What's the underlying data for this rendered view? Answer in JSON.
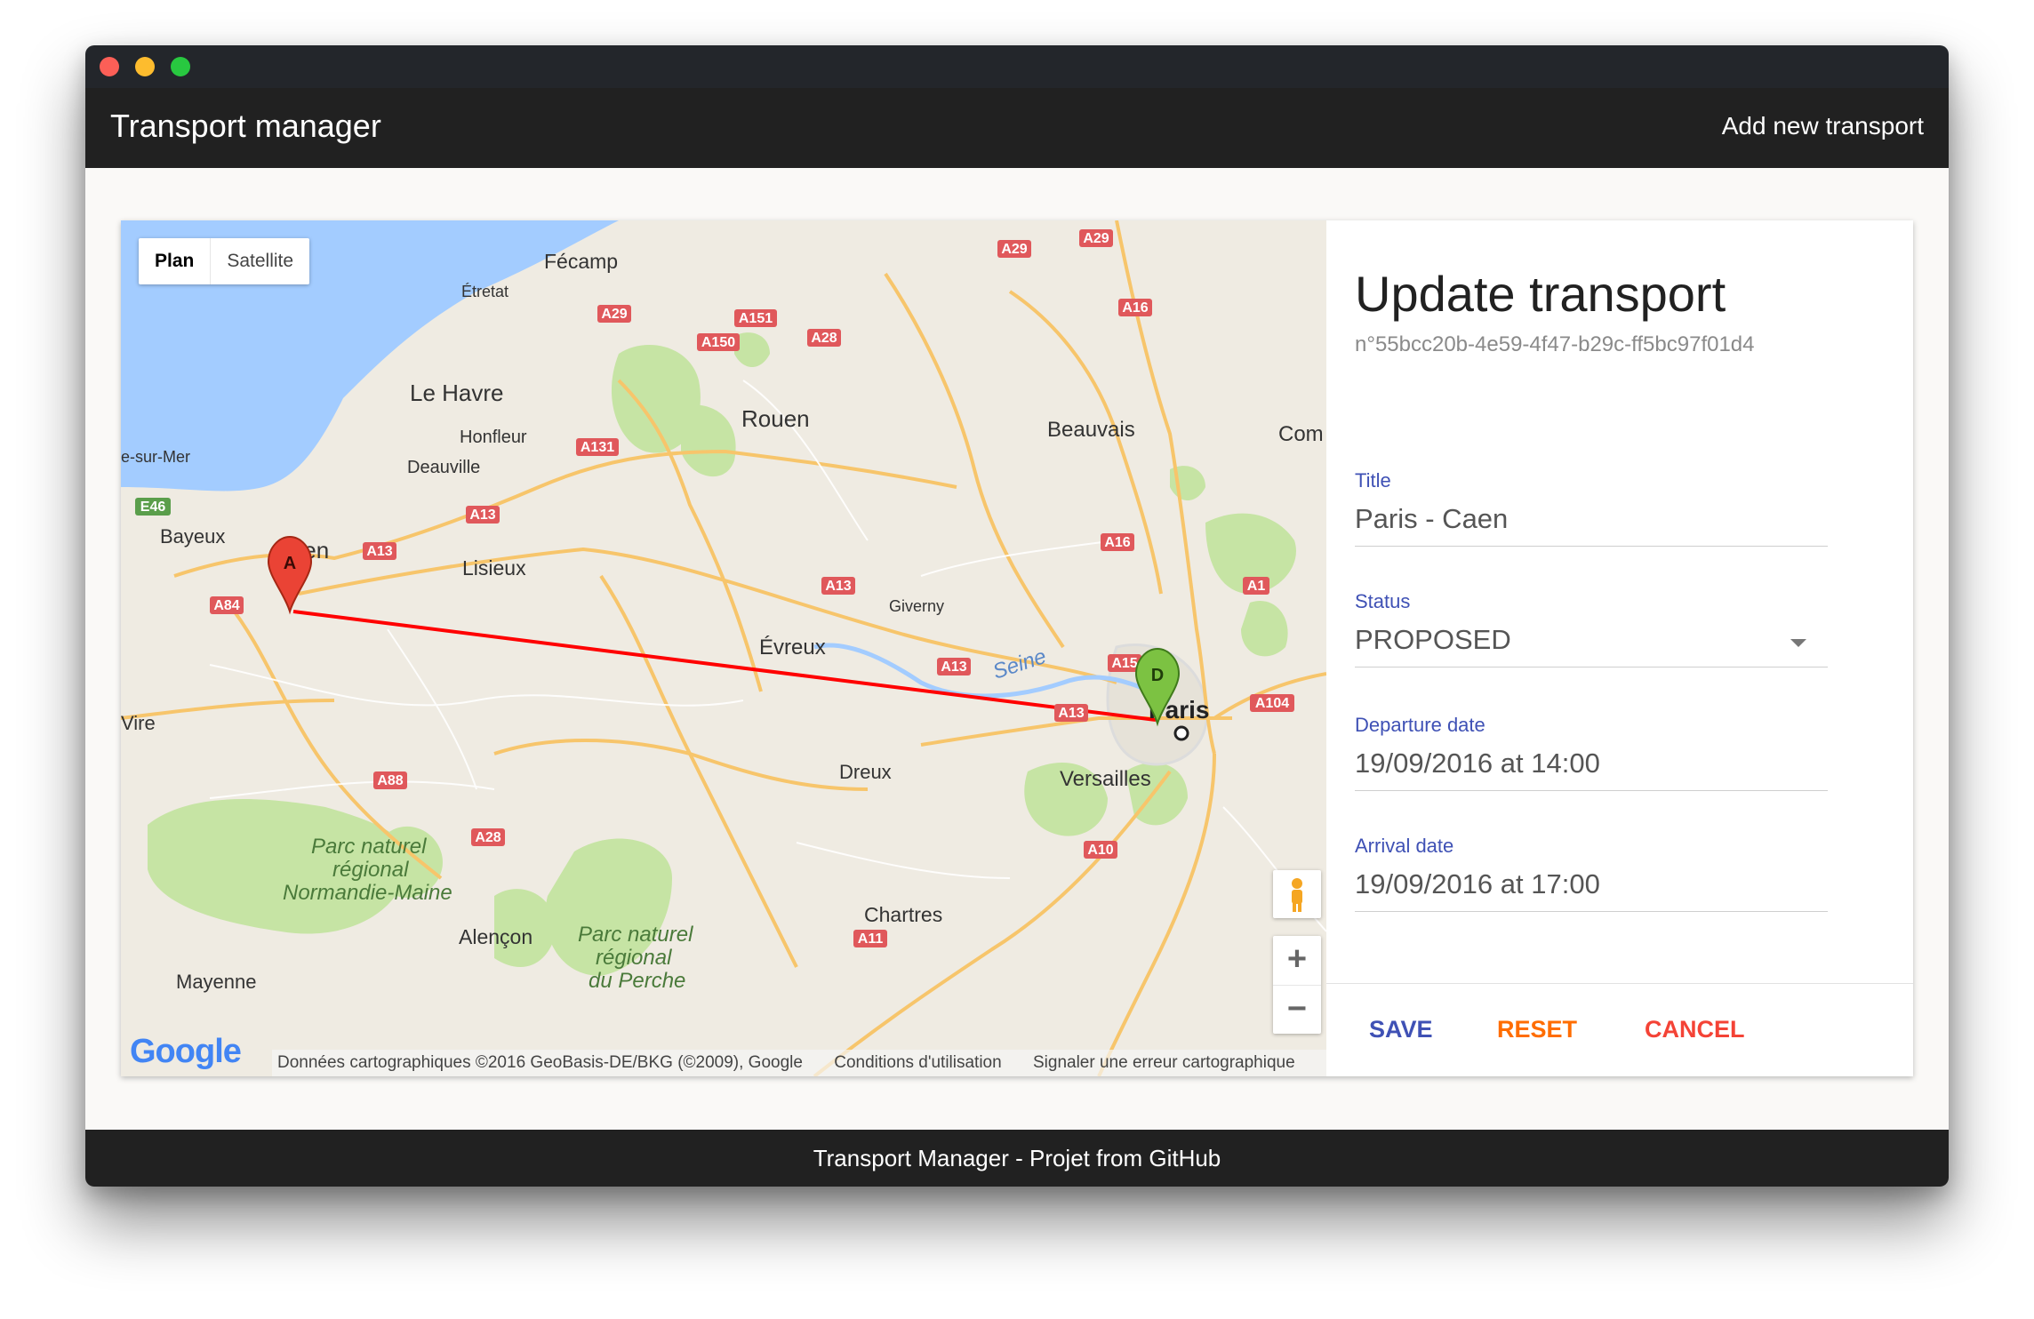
{
  "app": {
    "title": "Transport manager",
    "add_link": "Add new transport"
  },
  "map": {
    "type_plan": "Plan",
    "type_satellite": "Satellite",
    "labels": {
      "fecamp": "Fécamp",
      "etretat": "Étretat",
      "lehavre": "Le Havre",
      "honfleur": "Honfleur",
      "deauville": "Deauville",
      "rouen": "Rouen",
      "beauvais": "Beauvais",
      "surmer": "e-sur-Mer",
      "bayeux": "Bayeux",
      "caen": "Caen",
      "lisieux": "Lisieux",
      "evreux": "Évreux",
      "giverny": "Giverny",
      "seine": "Seine",
      "paris": "Paris",
      "versailles": "Versailles",
      "vire": "Vire",
      "dreux": "Dreux",
      "parc1_l1": "Parc naturel",
      "parc1_l2": "régional",
      "parc1_l3": "Normandie-Maine",
      "alencon": "Alençon",
      "parc2_l1": "Parc naturel",
      "parc2_l2": "régional",
      "parc2_l3": "du Perche",
      "chartres": "Chartres",
      "mayenne": "Mayenne",
      "com": "Com"
    },
    "roads": {
      "a29a": "A29",
      "a29b": "A29",
      "a29c": "A29",
      "a16a": "A16",
      "a151": "A151",
      "a150": "A150",
      "a28a": "A28",
      "a131": "A131",
      "e46": "E46",
      "a13a": "A13",
      "a13b": "A13",
      "a16b": "A16",
      "a84": "A84",
      "a13c": "A13",
      "a1": "A1",
      "a13d": "A13",
      "a15": "A15",
      "a13e": "A13",
      "a104": "A104",
      "a88": "A88",
      "a28b": "A28",
      "a10": "A10",
      "a11": "A11"
    },
    "marker_a": "A",
    "marker_d": "D",
    "zoom_in": "+",
    "zoom_out": "−",
    "attribution": "Données cartographiques ©2016 GeoBasis-DE/BKG (©2009), Google",
    "terms": "Conditions d'utilisation",
    "report": "Signaler une erreur cartographique",
    "google_logo": "Google",
    "colors": {
      "water": "#a3ccff",
      "route": "#ff0000",
      "park": "#c6e4a4"
    }
  },
  "form": {
    "title": "Update transport",
    "id": "n°55bcc20b-4e59-4f47-b29c-ff5bc97f01d4",
    "fields": {
      "title_label": "Title",
      "title_value": "Paris - Caen",
      "status_label": "Status",
      "status_value": "PROPOSED",
      "departure_label": "Departure date",
      "departure_value": "19/09/2016 at 14:00",
      "arrival_label": "Arrival date",
      "arrival_value": "19/09/2016 at 17:00"
    },
    "actions": {
      "save": "SAVE",
      "reset": "RESET",
      "cancel": "CANCEL"
    }
  },
  "footer": {
    "text": "Transport Manager - Projet from GitHub"
  }
}
